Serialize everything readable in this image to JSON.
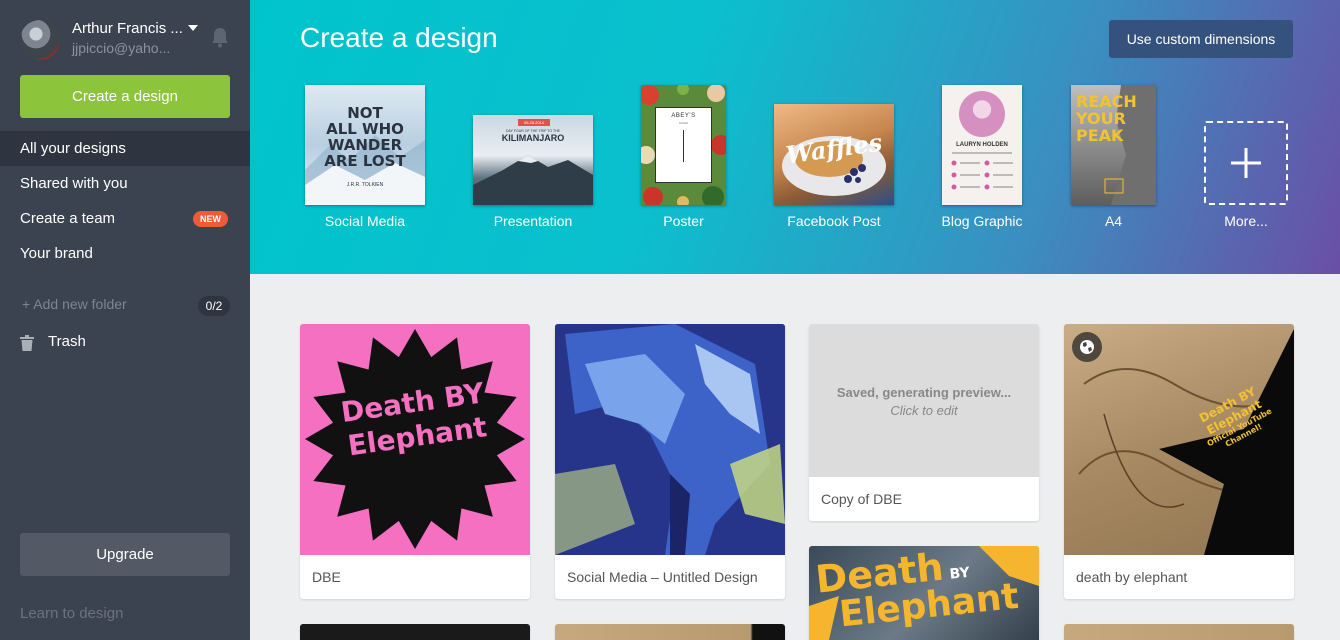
{
  "user": {
    "name": "Arthur Francis ...",
    "email": "jjpiccio@yaho..."
  },
  "sidebar": {
    "create_button": "Create a design",
    "items": [
      {
        "label": "All your designs",
        "active": true
      },
      {
        "label": "Shared with you"
      },
      {
        "label": "Create a team",
        "badge": "NEW"
      },
      {
        "label": "Your brand"
      }
    ],
    "add_folder": "+ Add new folder",
    "folder_count": "0/2",
    "trash": "Trash",
    "upgrade": "Upgrade",
    "learn": "Learn to design"
  },
  "header": {
    "title": "Create a design",
    "custom_dimensions": "Use custom dimensions",
    "templates": [
      {
        "label": "Social Media",
        "thumb_text": [
          "NOT",
          "ALL WHO",
          "WANDER",
          "ARE LOST"
        ],
        "thumb_caption": "J.R.R. TOLKIEN"
      },
      {
        "label": "Presentation",
        "thumb_badge": "05.28.2014",
        "thumb_small": "DAY FOUR OF THE TRIP TO THE",
        "thumb_text": "KILIMANJARO"
      },
      {
        "label": "Poster",
        "thumb_text": "ABEY'S",
        "thumb_small": "SUSHI"
      },
      {
        "label": "Facebook Post",
        "thumb_text": "Waffles"
      },
      {
        "label": "Blog Graphic",
        "thumb_text": "LAURYN HOLDEN"
      },
      {
        "label": "A4",
        "thumb_text": [
          "REACH",
          "YOUR",
          "PEAK"
        ]
      },
      {
        "label": "More..."
      }
    ]
  },
  "designs": [
    {
      "title": "DBE",
      "thumb_text": [
        "Death BY",
        "Elephant"
      ]
    },
    {
      "title": "Social Media – Untitled Design"
    },
    {
      "title": "Copy of DBE",
      "status": "Saved, generating preview...",
      "hint": "Click to edit"
    },
    {
      "title": "death by elephant",
      "thumb_text": [
        "Death BY Elephant",
        "Official YouTube",
        "Channel!"
      ]
    },
    {
      "title": "",
      "thumb_text": [
        "Death",
        "BY",
        "Elephant"
      ]
    }
  ],
  "colors": {
    "sidebar_bg": "#3c4350",
    "accent_green": "#8cc43c",
    "badge_red": "#ef5b36",
    "header_teal": "#00c4cc",
    "header_purple": "#6a4fa6",
    "dbe_pink": "#f570c0"
  },
  "icons": [
    "bell-icon",
    "caret-down-icon",
    "trash-icon",
    "plus-icon",
    "globe-icon"
  ]
}
